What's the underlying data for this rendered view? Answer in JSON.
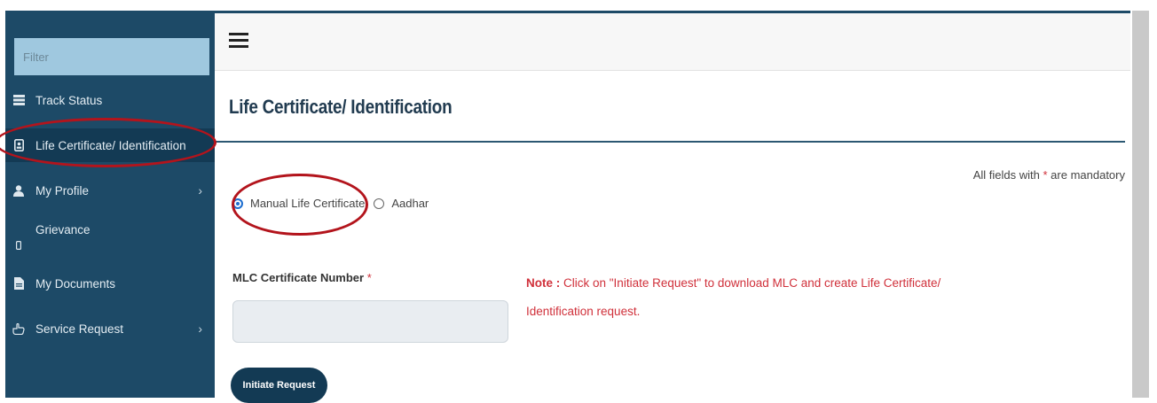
{
  "sidebar": {
    "filter_placeholder": "Filter",
    "items": [
      {
        "label": "Track Status",
        "icon": "list-icon",
        "has_chevron": false
      },
      {
        "label": "Life Certificate/ Identification",
        "icon": "id-badge-icon",
        "has_chevron": false
      },
      {
        "label": "My Profile",
        "icon": "user-icon",
        "has_chevron": true,
        "chevron": "›"
      },
      {
        "label": "Grievance",
        "icon": "mobile-icon",
        "has_chevron": false
      },
      {
        "label": "My Documents",
        "icon": "document-icon",
        "has_chevron": false
      },
      {
        "label": "Service Request",
        "icon": "hand-pointer-icon",
        "has_chevron": true,
        "chevron": "›"
      }
    ]
  },
  "main": {
    "title": "Life Certificate/ Identification",
    "mandatory_text": "All fields with ",
    "mandatory_star": "*",
    "mandatory_suffix": " are mandatory",
    "radio_options": [
      {
        "label": "Manual Life Certificate",
        "selected": true
      },
      {
        "label": "Aadhar",
        "selected": false
      }
    ],
    "field_label": "MLC Certificate Number",
    "field_star": "*",
    "field_value": "",
    "note_prefix": "Note :",
    "note_text": " Click on \"Initiate Request\" to download MLC and create Life Certificate/ Identification request.",
    "button_label": "Initiate Request"
  },
  "colors": {
    "sidebar_bg": "#1d4a67",
    "accent_dark": "#133a54",
    "note_red": "#d0303a",
    "annotation_red": "#b3141c"
  }
}
